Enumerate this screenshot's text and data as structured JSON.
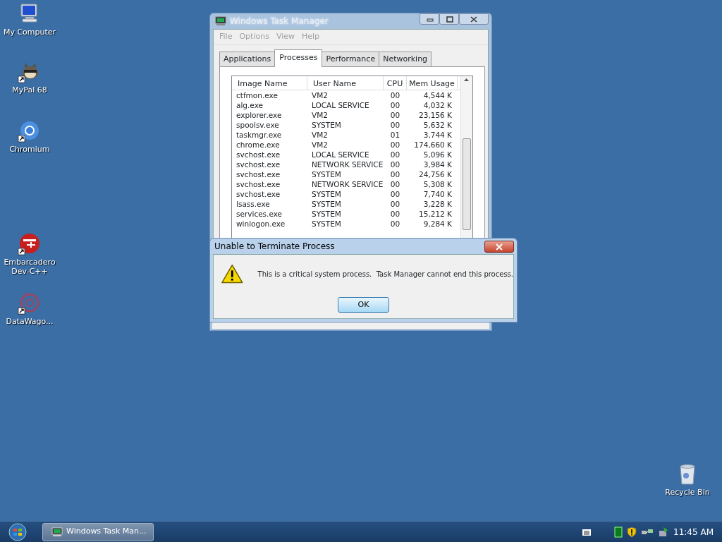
{
  "desktop_icons": [
    {
      "label": "My Computer",
      "kind": "computer",
      "shortcut": false
    },
    {
      "label": "MyPal 68",
      "kind": "raccoon",
      "shortcut": true
    },
    {
      "label": "Chromium",
      "kind": "chromium",
      "shortcut": true
    },
    {
      "label": "Embarcadero Dev-C++",
      "kind": "devcpp",
      "shortcut": true
    },
    {
      "label": "DataWago...",
      "kind": "datawagon",
      "shortcut": true
    },
    {
      "label": "Recycle Bin",
      "kind": "recycle",
      "shortcut": false
    }
  ],
  "task_manager": {
    "title": "Windows Task Manager",
    "active": false,
    "menu": [
      "File",
      "Options",
      "View",
      "Help"
    ],
    "tabs": [
      {
        "label": "Applications",
        "selected": false
      },
      {
        "label": "Processes",
        "selected": true
      },
      {
        "label": "Performance",
        "selected": false
      },
      {
        "label": "Networking",
        "selected": false
      }
    ],
    "columns": [
      "Image Name",
      "User Name",
      "CPU",
      "Mem Usage"
    ],
    "rows": [
      {
        "image_name": "ctfmon.exe",
        "user_name": "VM2",
        "cpu": "00",
        "mem_usage": "4,544 K"
      },
      {
        "image_name": "alg.exe",
        "user_name": "LOCAL SERVICE",
        "cpu": "00",
        "mem_usage": "4,032 K"
      },
      {
        "image_name": "explorer.exe",
        "user_name": "VM2",
        "cpu": "00",
        "mem_usage": "23,156 K"
      },
      {
        "image_name": "spoolsv.exe",
        "user_name": "SYSTEM",
        "cpu": "00",
        "mem_usage": "5,632 K"
      },
      {
        "image_name": "taskmgr.exe",
        "user_name": "VM2",
        "cpu": "01",
        "mem_usage": "3,744 K"
      },
      {
        "image_name": "chrome.exe",
        "user_name": "VM2",
        "cpu": "00",
        "mem_usage": "174,660 K"
      },
      {
        "image_name": "svchost.exe",
        "user_name": "LOCAL SERVICE",
        "cpu": "00",
        "mem_usage": "5,096 K"
      },
      {
        "image_name": "svchost.exe",
        "user_name": "NETWORK SERVICE",
        "cpu": "00",
        "mem_usage": "3,984 K"
      },
      {
        "image_name": "svchost.exe",
        "user_name": "SYSTEM",
        "cpu": "00",
        "mem_usage": "24,756 K"
      },
      {
        "image_name": "svchost.exe",
        "user_name": "NETWORK SERVICE",
        "cpu": "00",
        "mem_usage": "5,308 K"
      },
      {
        "image_name": "svchost.exe",
        "user_name": "SYSTEM",
        "cpu": "00",
        "mem_usage": "7,740 K"
      },
      {
        "image_name": "lsass.exe",
        "user_name": "SYSTEM",
        "cpu": "00",
        "mem_usage": "3,228 K"
      },
      {
        "image_name": "services.exe",
        "user_name": "SYSTEM",
        "cpu": "00",
        "mem_usage": "15,212 K"
      },
      {
        "image_name": "winlogon.exe",
        "user_name": "SYSTEM",
        "cpu": "00",
        "mem_usage": "9,284 K"
      }
    ]
  },
  "dialog": {
    "title": "Unable to Terminate Process",
    "message": "This is a critical system process.  Task Manager cannot end this process.",
    "button": "OK"
  },
  "taskbar": {
    "tasks": [
      {
        "label": "Windows Task Man...",
        "selected": true
      }
    ],
    "clock": "11:45 AM"
  }
}
